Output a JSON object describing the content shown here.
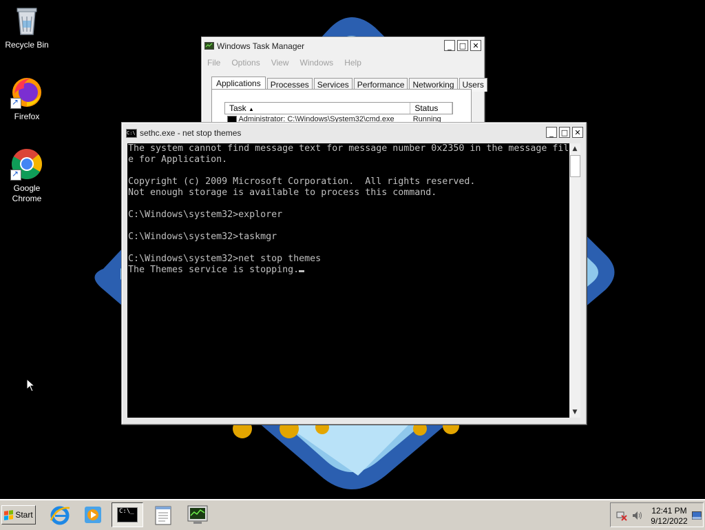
{
  "desktop": {
    "icons": [
      {
        "label": "Recycle Bin",
        "icon": "recycle-bin-icon"
      },
      {
        "label": "Firefox",
        "icon": "firefox-icon"
      },
      {
        "label": "Google Chrome",
        "icon": "chrome-icon"
      }
    ]
  },
  "task_manager": {
    "title": "Windows Task Manager",
    "menu": [
      "File",
      "Options",
      "View",
      "Windows",
      "Help"
    ],
    "tabs": [
      "Applications",
      "Processes",
      "Services",
      "Performance",
      "Networking",
      "Users"
    ],
    "active_tab": "Applications",
    "columns": [
      "Task",
      "Status"
    ],
    "rows": [
      {
        "task": "Administrator: C:\\Windows\\System32\\cmd.exe",
        "status": "Running"
      }
    ]
  },
  "console": {
    "title": "sethc.exe - net  stop themes",
    "lines": [
      "The system cannot find message text for message number 0x2350 in the message fil",
      "e for Application.",
      "",
      "Copyright (c) 2009 Microsoft Corporation.  All rights reserved.",
      "Not enough storage is available to process this command.",
      "",
      "C:\\Windows\\system32>explorer",
      "",
      "C:\\Windows\\system32>taskmgr",
      "",
      "C:\\Windows\\system32>net stop themes",
      "The Themes service is stopping."
    ],
    "colors": {
      "background": "#000000",
      "text": "#c0c0c0"
    }
  },
  "taskbar": {
    "start_label": "Start",
    "items": [
      {
        "icon": "internet-explorer-icon"
      },
      {
        "icon": "media-player-icon"
      },
      {
        "icon": "command-prompt-icon",
        "active": true
      },
      {
        "icon": "notepad-icon"
      },
      {
        "icon": "task-manager-icon"
      }
    ],
    "clock_time": "12:41 PM",
    "clock_date": "9/12/2022"
  }
}
